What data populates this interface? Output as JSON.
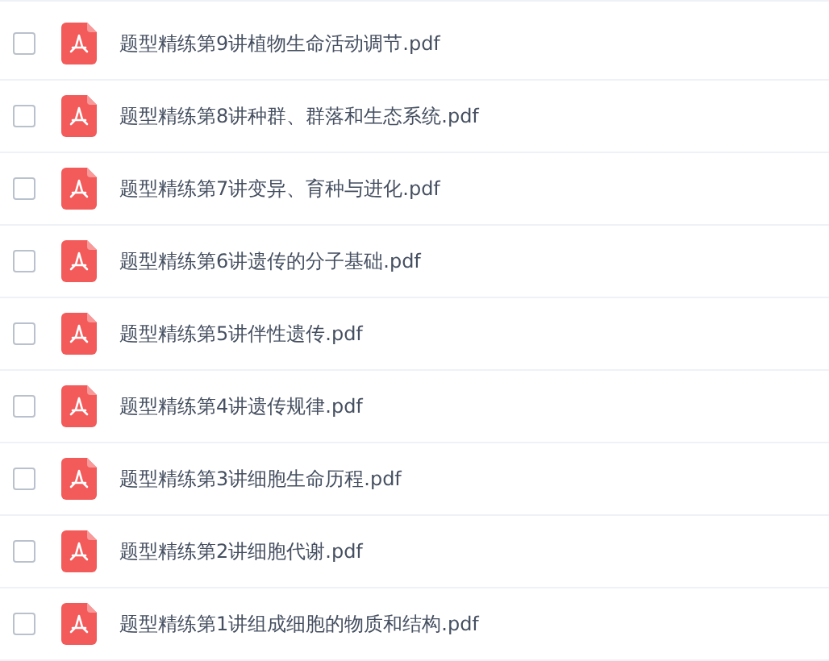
{
  "files": [
    {
      "name": "题型精练第9讲植物生命活动调节.pdf",
      "checked": false
    },
    {
      "name": "题型精练第8讲种群、群落和生态系统.pdf",
      "checked": false
    },
    {
      "name": "题型精练第7讲变异、育种与进化.pdf",
      "checked": false
    },
    {
      "name": "题型精练第6讲遗传的分子基础.pdf",
      "checked": false
    },
    {
      "name": "题型精练第5讲伴性遗传.pdf",
      "checked": false
    },
    {
      "name": "题型精练第4讲遗传规律.pdf",
      "checked": false
    },
    {
      "name": "题型精练第3讲细胞生命历程.pdf",
      "checked": false
    },
    {
      "name": "题型精练第2讲细胞代谢.pdf",
      "checked": false
    },
    {
      "name": "题型精练第1讲组成细胞的物质和结构.pdf",
      "checked": false
    }
  ]
}
